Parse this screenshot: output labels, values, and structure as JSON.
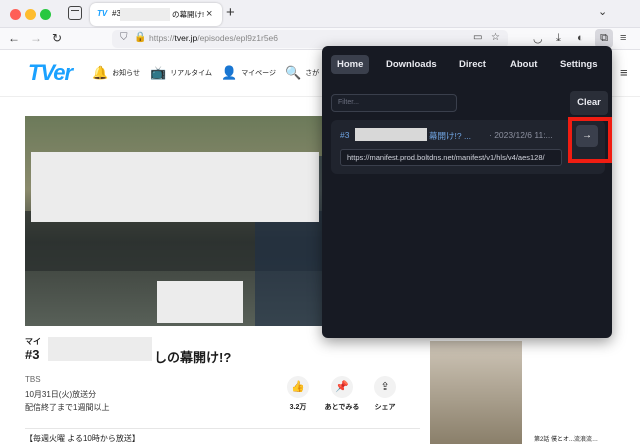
{
  "browser": {
    "tab_title": "#3",
    "tab_title_tail": "の幕開け!",
    "tab_close": "×",
    "new_tab": "+",
    "url": "https://tver.jp/episodes/epl9z1r5e6",
    "url_host_part": "tver.jp",
    "url_path_part": "/episodes/epl9z1r5e6",
    "url_prefix": "https://",
    "back": "←",
    "forward": "→",
    "reload": "↻"
  },
  "site": {
    "logo": "TVer",
    "nav": [
      {
        "icon": "bell-icon",
        "glyph": "🔔",
        "label": "お知らせ"
      },
      {
        "icon": "tv-icon",
        "glyph": "📺",
        "label": "リアルタイム"
      },
      {
        "icon": "person-icon",
        "glyph": "👤",
        "label": "マイページ"
      },
      {
        "icon": "search-icon",
        "glyph": "🔍",
        "label": "さが"
      }
    ]
  },
  "episode": {
    "series_prefix": "マイ",
    "title_prefix": "#3",
    "title_suffix": "しの幕開け!?",
    "broadcaster": "TBS",
    "air_date": "10月31日(火)放送分",
    "expiry": "配信終了まで1週間以上",
    "likes": "3.2万",
    "watch_later": "あとでみる",
    "share": "シェア",
    "schedule": "【毎週火曜 よる10時から放送】"
  },
  "related": {
    "caption": "第2話 僕とオ...流浪流…"
  },
  "popup": {
    "tabs": [
      "Home",
      "Downloads",
      "Direct",
      "About",
      "Settings"
    ],
    "active_tab": "Home",
    "filter_placeholder": "Filter...",
    "clear_label": "Clear",
    "item": {
      "title_prefix": "#3",
      "title_suffix": "幕開け!? ...",
      "date": "· 2023/12/6 11:...",
      "url": "https://manifest.prod.boltdns.net/manifest/v1/hls/v4/aes128/",
      "go": "→"
    }
  },
  "colors": {
    "brand": "#1aa1ff",
    "popup_bg": "#171a23",
    "highlight": "#f01d12"
  }
}
